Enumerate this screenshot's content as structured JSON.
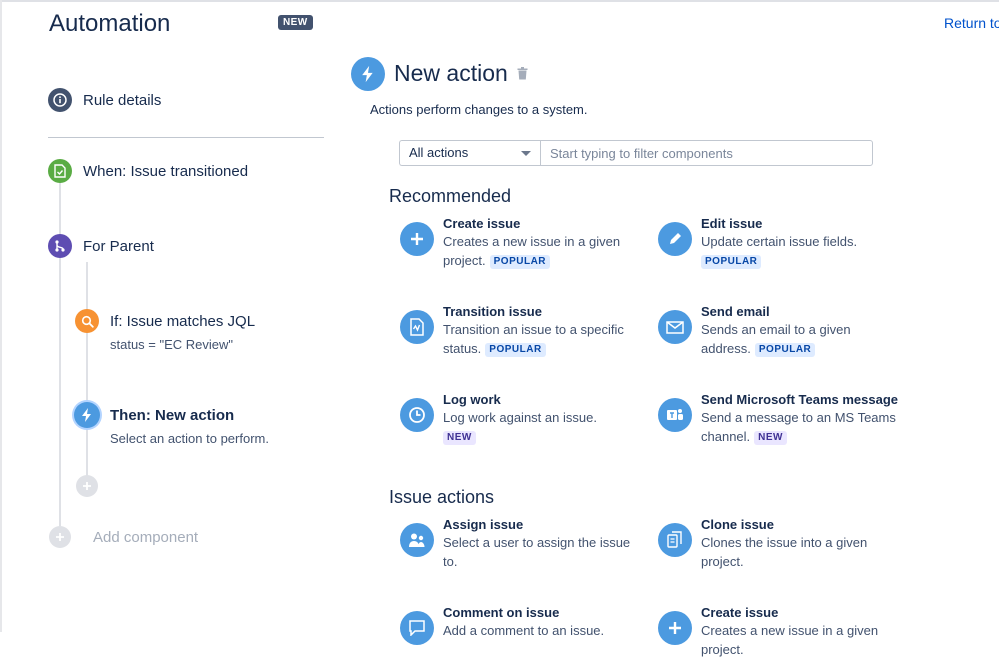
{
  "app": {
    "title": "Automation",
    "badge": "NEW",
    "return_link": "Return to"
  },
  "sidebar": {
    "rule_details": "Rule details",
    "trigger": "When: Issue transitioned",
    "branch": "For Parent",
    "condition": {
      "label": "If: Issue matches JQL",
      "sub": "status = \"EC Review\""
    },
    "action": {
      "label": "Then: New action",
      "sub": "Select an action to perform."
    },
    "add_component": "Add component"
  },
  "panel": {
    "title": "New action",
    "description": "Actions perform changes to a system.",
    "filter_select": "All actions",
    "filter_placeholder": "Start typing to filter components"
  },
  "sections": {
    "recommended": {
      "heading": "Recommended",
      "items": [
        {
          "name": "Create issue",
          "desc": "Creates a new issue in a given project.",
          "badge": "POPULAR",
          "icon": "plus-icon"
        },
        {
          "name": "Edit issue",
          "desc": "Update certain issue fields.",
          "badge": "POPULAR",
          "icon": "pencil-icon"
        },
        {
          "name": "Transition issue",
          "desc": "Transition an issue to a specific status.",
          "badge": "POPULAR",
          "icon": "transition-icon"
        },
        {
          "name": "Send email",
          "desc": "Sends an email to a given address.",
          "badge": "POPULAR",
          "icon": "envelope-icon"
        },
        {
          "name": "Log work",
          "desc": "Log work against an issue.",
          "badge": "NEW",
          "icon": "clock-icon"
        },
        {
          "name": "Send Microsoft Teams message",
          "desc": "Send a message to an MS Teams channel.",
          "badge": "NEW",
          "icon": "teams-icon"
        }
      ]
    },
    "issue_actions": {
      "heading": "Issue actions",
      "items": [
        {
          "name": "Assign issue",
          "desc": "Select a user to assign the issue to.",
          "icon": "assign-user-icon"
        },
        {
          "name": "Clone issue",
          "desc": "Clones the issue into a given project.",
          "icon": "clone-icon"
        },
        {
          "name": "Comment on issue",
          "desc": "Add a comment to an issue.",
          "icon": "comment-icon"
        },
        {
          "name": "Create issue",
          "desc": "Creates a new issue in a given project.",
          "icon": "plus-icon"
        }
      ]
    }
  },
  "colors": {
    "accent": "#4C9AE0",
    "trigger": "#5AAC44",
    "branch": "#5E4DB2",
    "condition": "#F79232",
    "rule_details": "#42526E"
  }
}
